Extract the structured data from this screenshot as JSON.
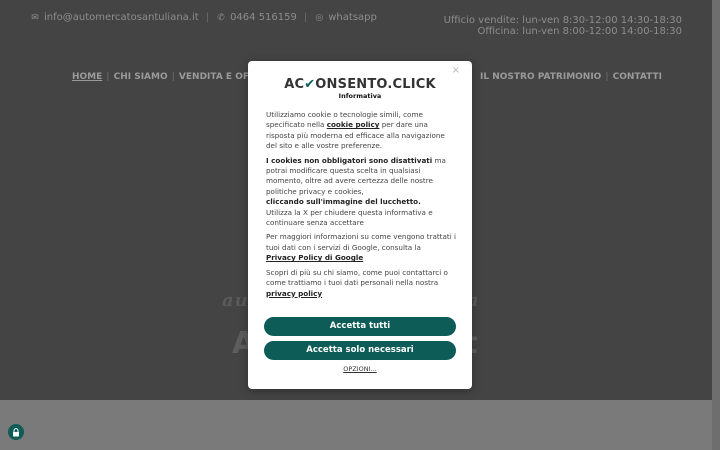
{
  "topbar": {
    "email": "info@automercatosantuliana.it",
    "phone": "0464 516159",
    "whatsapp": "whatsapp"
  },
  "hours": {
    "line1": "Ufficio vendite: lun-ven 8:30-12:00 14:30-18:30",
    "line2": "Officina: lun-ven 8:00-12:00 14:00-18:30"
  },
  "nav": {
    "home": "HOME",
    "about": "CHI SIAMO",
    "sales": "VENDITA E OFFICINA",
    "heritage": "IL NOSTRO PATRIMONIO",
    "contacts": "CONTATTI"
  },
  "hero": {
    "line1": "au",
    "line1b": "na",
    "line2a": "A",
    "line2b": "t"
  },
  "modal": {
    "logo_a": "AC",
    "logo_b": "ONSENTO",
    "logo_c": ".CLICK",
    "subtitle": "Informativa",
    "close": "×",
    "p1_pre": "Utilizziamo cookie o tecnologie simili, come specificato nella ",
    "p1_link": "cookie policy",
    "p1_post": " per dare una risposta più moderna ed efficace alla navigazione del sito e alle vostre preferenze.",
    "p2_bold": "I cookies non obbligatori sono disattivati",
    "p2_mid": " ma potrai modificare questa scelta in qualsiasi momento, oltre ad avere certezza delle nostre politiche privacy e cookies,",
    "p2_bold2": "cliccando sull'immagine del lucchetto.",
    "p2_end": "Utilizza la X per chiudere questa informativa e continuare senza accettare",
    "p3_pre": "Per maggiori informazioni su come vengono trattati i tuoi dati con i servizi di Google, consulta la ",
    "p3_link": "Privacy Policy di Google",
    "p4_pre": "Scopri di più su chi siamo, come puoi contattarci o come trattiamo i tuoi dati personali nella nostra ",
    "p4_link": "privacy policy",
    "accept_all": "Accetta tutti",
    "accept_necessary": "Accetta solo necessari",
    "options": "OPZIONI..."
  },
  "colors": {
    "accent": "#0d5c57",
    "overlay": "#444444"
  }
}
